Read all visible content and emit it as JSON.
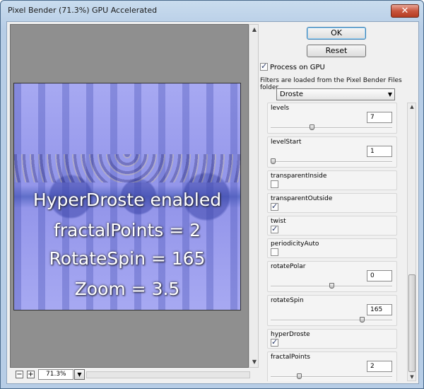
{
  "window": {
    "title": "Pixel Bender (71.3%) GPU Accelerated",
    "close_glyph": "✕"
  },
  "preview": {
    "overlay_lines": [
      "HyperDroste enabled",
      "fractalPoints = 2",
      "RotateSpin = 165",
      "Zoom = 3.5"
    ],
    "zoom_value": "71.3%",
    "zoom_out_glyph": "−",
    "zoom_in_glyph": "+"
  },
  "buttons": {
    "ok": "OK",
    "reset": "Reset"
  },
  "gpu": {
    "label": "Process on GPU",
    "checked": true
  },
  "note": "Filters are loaded from the Pixel Bender Files folder.",
  "filter": {
    "selected": "Droste"
  },
  "params": [
    {
      "name": "levels",
      "type": "slider",
      "value": "7",
      "fraction": 0.33
    },
    {
      "name": "levelStart",
      "type": "slider",
      "value": "1",
      "fraction": 0.0
    },
    {
      "name": "transparentInside",
      "type": "checkbox",
      "checked": false
    },
    {
      "name": "transparentOutside",
      "type": "checkbox",
      "checked": true
    },
    {
      "name": "twist",
      "type": "checkbox",
      "checked": true
    },
    {
      "name": "periodicityAuto",
      "type": "checkbox",
      "checked": false
    },
    {
      "name": "rotatePolar",
      "type": "slider",
      "value": "0",
      "fraction": 0.5
    },
    {
      "name": "rotateSpin",
      "type": "slider",
      "value": "165",
      "fraction": 0.76
    },
    {
      "name": "hyperDroste",
      "type": "checkbox",
      "checked": true
    },
    {
      "name": "fractalPoints",
      "type": "slider",
      "value": "2",
      "fraction": 0.22
    }
  ]
}
